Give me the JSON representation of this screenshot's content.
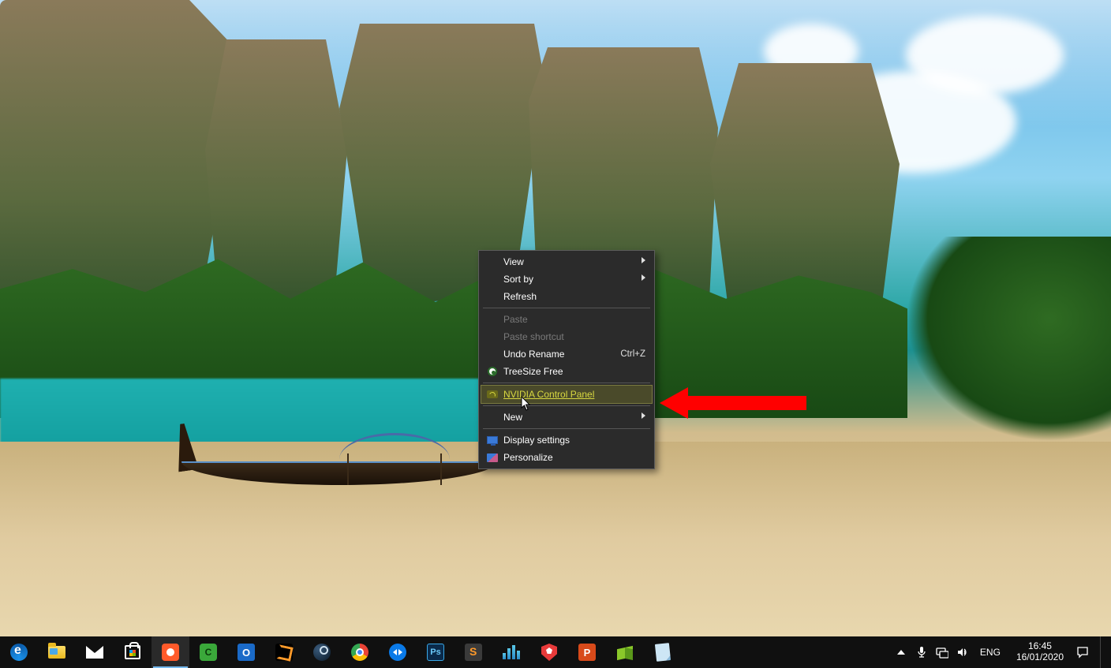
{
  "context_menu": {
    "items": {
      "view": {
        "label": "View",
        "submenu": true
      },
      "sort_by": {
        "label": "Sort by",
        "submenu": true
      },
      "refresh": {
        "label": "Refresh"
      },
      "paste": {
        "label": "Paste",
        "disabled": true
      },
      "paste_shortcut": {
        "label": "Paste shortcut",
        "disabled": true
      },
      "undo_rename": {
        "label": "Undo Rename",
        "accel": "Ctrl+Z"
      },
      "treesize": {
        "label": "TreeSize Free"
      },
      "nvidia": {
        "label": "NVIDIA Control Panel",
        "hovered": true
      },
      "new": {
        "label": "New",
        "submenu": true
      },
      "display_settings": {
        "label": "Display settings"
      },
      "personalize": {
        "label": "Personalize"
      }
    }
  },
  "taskbar": {
    "apps": {
      "edge": "Microsoft Edge",
      "explorer": "File Explorer",
      "mail": "Mail",
      "store": "Microsoft Store",
      "camtasia_rec": "Camtasia Recorder",
      "camtasia": "Camtasia",
      "outlook": "Outlook",
      "app_orange": "Application",
      "steam": "Steam",
      "chrome": "Google Chrome",
      "teamviewer": "TeamViewer",
      "photoshop": "Adobe Photoshop",
      "sublime": "Sublime Text",
      "bars_app": "Application",
      "shield_app": "Brave",
      "powerpoint": "PowerPoint",
      "cube_app": "Application",
      "note_app": "Application"
    },
    "tray": {
      "language": "ENG",
      "time": "16:45",
      "date": "16/01/2020"
    }
  }
}
